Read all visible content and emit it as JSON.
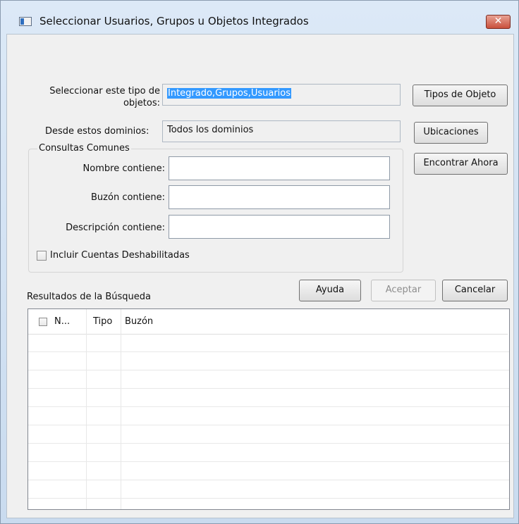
{
  "window": {
    "title": "Seleccionar Usuarios, Grupos u Objetos Integrados",
    "close_symbol": "✕"
  },
  "form": {
    "object_type_label_line1": "Seleccionar este tipo de",
    "object_type_label_line2": "objetos:",
    "object_type_value": "Integrado,Grupos,Usuarios",
    "domains_label": "Desde estos dominios:",
    "domains_value": "Todos los dominios"
  },
  "buttons": {
    "object_types": "Tipos de Objeto",
    "locations": "Ubicaciones",
    "find_now": "Encontrar Ahora",
    "help": "Ayuda",
    "accept": "Aceptar",
    "cancel": "Cancelar"
  },
  "common_queries": {
    "title": "Consultas Comunes",
    "name_label": "Nombre contiene:",
    "mailbox_label": "Buzón contiene:",
    "description_label": "Descripción contiene:",
    "disabled_accounts": "Incluir Cuentas Deshabilitadas"
  },
  "results": {
    "title": "Resultados de la Búsqueda",
    "columns": [
      "N...",
      "Tipo",
      "Buzón"
    ]
  },
  "colors": {
    "selection": "#3399ff",
    "close": "#c9503c"
  },
  "icons": [
    "app-window-icon",
    "close-icon",
    "checkbox-icon"
  ]
}
